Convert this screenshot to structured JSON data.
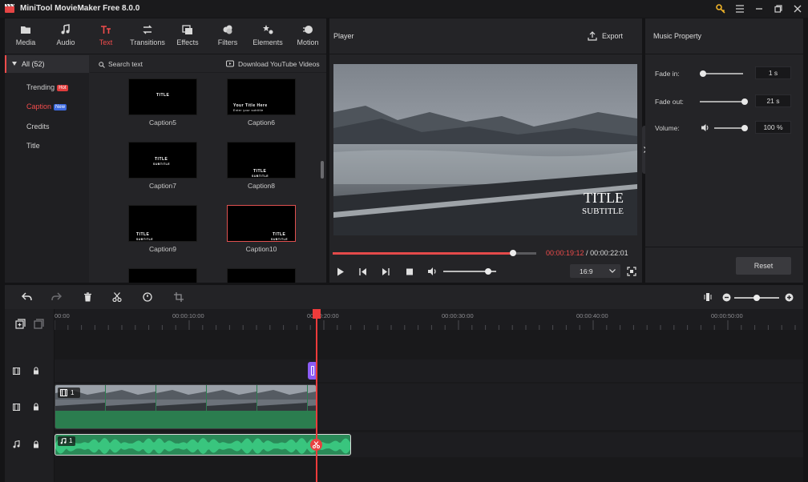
{
  "app": {
    "title": "MiniTool MovieMaker Free 8.0.0"
  },
  "toolbar": {
    "tabs": [
      {
        "label": "Media",
        "icon": "folder-icon"
      },
      {
        "label": "Audio",
        "icon": "music-icon"
      },
      {
        "label": "Text",
        "icon": "text-icon",
        "active": true
      },
      {
        "label": "Transitions",
        "icon": "transitions-icon"
      },
      {
        "label": "Effects",
        "icon": "effects-icon"
      },
      {
        "label": "Filters",
        "icon": "filters-icon"
      },
      {
        "label": "Elements",
        "icon": "elements-icon"
      },
      {
        "label": "Motion",
        "icon": "motion-icon"
      }
    ]
  },
  "sidebar": {
    "all_label": "All (52)",
    "items": [
      {
        "label": "Trending",
        "badge": "Hot"
      },
      {
        "label": "Caption",
        "badge": "New",
        "active": true
      },
      {
        "label": "Credits"
      },
      {
        "label": "Title"
      }
    ]
  },
  "library": {
    "search_placeholder": "Search text",
    "download_label": "Download YouTube Videos",
    "captions": [
      {
        "label": "Caption5",
        "line1": "TITLE",
        "line2": ""
      },
      {
        "label": "Caption6",
        "line1": "Your Title Here",
        "line2": "Enter your subtitle"
      },
      {
        "label": "Caption7",
        "line1": "TITLE",
        "line2": "SUBTITLE"
      },
      {
        "label": "Caption8",
        "line1": "TITLE",
        "line2": "SUBTITLE"
      },
      {
        "label": "Caption9",
        "line1": "TITLE",
        "line2": "SUBTITLE"
      },
      {
        "label": "Caption10",
        "line1": "TITLE",
        "line2": "SUBTITLE"
      }
    ]
  },
  "player": {
    "title": "Player",
    "export_label": "Export",
    "overlay_title": "TITLE",
    "overlay_subtitle": "SUBTITLE",
    "current_time": "00:00:19:12",
    "separator": " / ",
    "total_time": "00:00:22:01",
    "progress": 0.886,
    "volume": 0.85,
    "aspect_ratio": "16:9"
  },
  "music_property": {
    "title": "Music Property",
    "fade_in_label": "Fade in:",
    "fade_in_value": "1 s",
    "fade_in_level": 0.07,
    "fade_out_label": "Fade out:",
    "fade_out_value": "21 s",
    "fade_out_level": 1.0,
    "volume_label": "Volume:",
    "volume_value": "100 %",
    "volume_level": 1.0,
    "reset_label": "Reset"
  },
  "timeline": {
    "ruler": [
      "00:00",
      "00:00:10:00",
      "00:00:20:00",
      "00:00:30:00",
      "00:00:40:00",
      "00:00:50:00"
    ],
    "video_clip_number": "1",
    "audio_clip_number": "1",
    "zoom_level": 0.5
  },
  "colors": {
    "accent": "#f24c4c",
    "video_clip": "#2b7d4f",
    "audio_clip": "#2a8a58",
    "caption_clip": "#8b5cf6"
  }
}
